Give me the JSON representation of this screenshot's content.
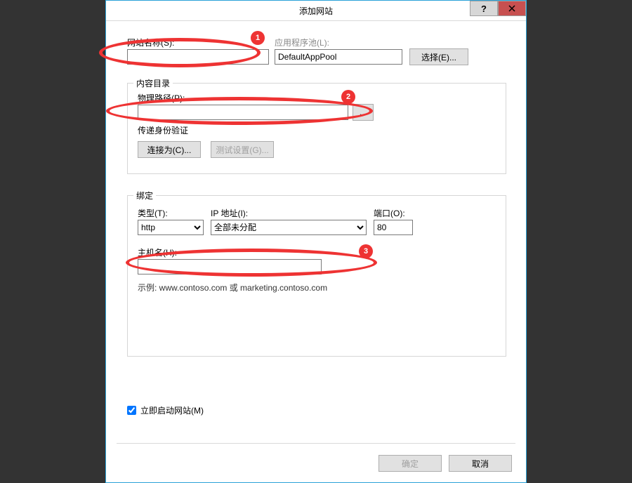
{
  "title": "添加网站",
  "labels": {
    "site_name": "网站名称(S):",
    "app_pool": "应用程序池(L):",
    "select": "选择(E)...",
    "content_group": "内容目录",
    "physical_path": "物理路径(P):",
    "browse": "...",
    "passthrough": "传递身份验证",
    "connect_as": "连接为(C)...",
    "test_settings": "测试设置(G)...",
    "binding_group": "绑定",
    "type": "类型(T):",
    "ip": "IP 地址(I):",
    "port": "端口(O):",
    "hostname": "主机名(H):",
    "example": "示例: www.contoso.com 或 marketing.contoso.com",
    "start_now": "立即启动网站(M)",
    "ok": "确定",
    "cancel": "取消"
  },
  "values": {
    "site_name": "",
    "app_pool": "DefaultAppPool",
    "physical_path": "",
    "type": "http",
    "ip": "全部未分配",
    "port": "80",
    "hostname": "",
    "start_now_checked": true
  },
  "callouts": {
    "c1": "1",
    "c2": "2",
    "c3": "3"
  }
}
